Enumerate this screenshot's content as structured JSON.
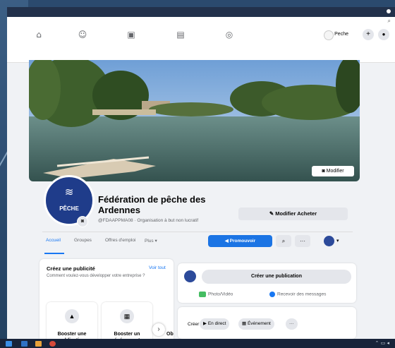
{
  "nav": {
    "profile_name": "Peche",
    "plus": "+",
    "messenger": "●"
  },
  "cover": {
    "edit_label": "Modifier"
  },
  "page": {
    "logo_text": "PÊCHE",
    "name_line1": "Fédération de pêche des",
    "name_line2": "Ardennes",
    "subtitle": "@FDAAPPMA08 · Organisation à but non lucratif",
    "edit_buy_label": "Modifier Acheter"
  },
  "tabs": [
    {
      "label": "Accueil",
      "active": true
    },
    {
      "label": "Groupes",
      "active": false
    },
    {
      "label": "Offres d'emploi",
      "active": false
    },
    {
      "label": "Plus ▾",
      "active": false
    }
  ],
  "actions": {
    "promote_label": "Promouvoir",
    "search": "⌕",
    "more": "···",
    "caret": "▾"
  },
  "ad_panel": {
    "title": "Créez une publicité",
    "see_all": "Voir tout",
    "description": "Comment voulez-vous développer votre entreprise ?",
    "boosts": [
      {
        "label": "Booster une publication",
        "icon": "thumbs-up-icon"
      },
      {
        "label": "Booster un événement",
        "icon": "calendar-icon"
      }
    ],
    "cut_text": "Ob"
  },
  "composer": {
    "create_label": "Créer une publication",
    "photo_label": "Photo/Vidéo",
    "messages_label": "Recevoir des messages",
    "creer_label": "Créer",
    "live_label": "En direct",
    "event_label": "Événement",
    "more": "···"
  },
  "colors": {
    "accent": "#1877f2",
    "page_bg": "#f0f2f5",
    "logo_bg": "#1f3c8a"
  }
}
